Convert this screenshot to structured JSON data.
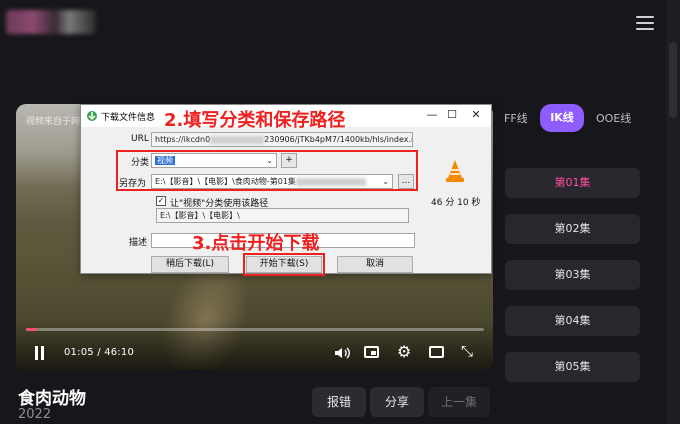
{
  "page": {
    "menu_icon": "hamburger-icon",
    "video": {
      "source_text": "视频来自于网",
      "current_time": "01:05",
      "separator": "/",
      "duration": "46:10",
      "progress_fraction": 0.024,
      "icons": [
        "pause-icon",
        "volume-icon",
        "pip-icon",
        "gear-icon",
        "fullscreen-icon",
        "expand-icon"
      ]
    },
    "title": "食肉动物",
    "year": "2022",
    "actions": {
      "report": "报错",
      "share": "分享",
      "prev": "上一集"
    },
    "lines": {
      "ff": "FF线",
      "ik": "IK线",
      "ooe": "OOE线"
    },
    "episodes": [
      "第01集",
      "第02集",
      "第03集",
      "第04集",
      "第05集"
    ],
    "dialog": {
      "title": "下载文件信息",
      "url_label": "URL",
      "url_prefix": "https://ikcdn0",
      "url_suffix": "230906/jTKb4pM7/1400kb/hls/index.m3u8",
      "category_label": "分类",
      "category_value": "视频",
      "add_button": "+",
      "save_as_label": "另存为",
      "save_path": "E:\\【影音】\\【电影】\\食肉动物-第01集",
      "browse_button": "...",
      "checkbox_label": "让\"视频\"分类使用该路径",
      "category_path": "E:\\【影音】\\【电影】\\",
      "desc_label": "描述",
      "duration_text": "46 分 10 秒",
      "later_button": "稍后下载(L)",
      "start_button": "开始下载(S)",
      "cancel_button": "取消",
      "minimize": "—",
      "maximize": "☐",
      "close": "✕"
    },
    "annotations": {
      "step2": "2.填写分类和保存路径",
      "step3": "3.点击开始下载"
    },
    "colors": {
      "accent": "#8e5cff",
      "active_episode": "#ff4fa0",
      "annotation": "#ef2020"
    }
  }
}
